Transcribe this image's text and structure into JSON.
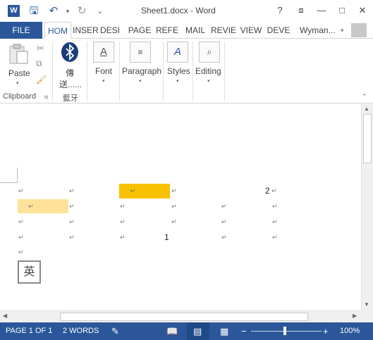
{
  "window": {
    "title": "Sheet1.docx - Word",
    "app_icon_letter": "W",
    "help": "?",
    "minimize": "—",
    "restore": "□",
    "close": "✕"
  },
  "qat": {
    "save": "🖫",
    "undo": "↶",
    "redo": "↻",
    "more": "⌄"
  },
  "tabs": {
    "file": "FILE",
    "items": [
      "HOM",
      "INSER",
      "DESI",
      "PAGE",
      "REFE",
      "MAIL",
      "REVIE",
      "VIEW",
      "DEVE"
    ],
    "user": "Wyman...",
    "user_caret": "▾"
  },
  "ribbon": {
    "paste": "Paste",
    "clipboard": "Clipboard",
    "bluetooth_line1": "傳",
    "bluetooth_line2": "送......",
    "bluetooth_group": "藍牙",
    "font": "Font",
    "paragraph": "Paragraph",
    "styles": "Styles",
    "editing": "Editing"
  },
  "document": {
    "mark": "↵",
    "cell_2": "2",
    "cell_1": "1",
    "ime_char": "英"
  },
  "status": {
    "page": "PAGE 1 OF 1",
    "words": "2 WORDS",
    "zoom": "100%",
    "zoom_level": 0.5
  },
  "colors": {
    "accent": "#2b579a",
    "highlight_orange": "#f7c100",
    "highlight_yellow": "#ffe299"
  }
}
